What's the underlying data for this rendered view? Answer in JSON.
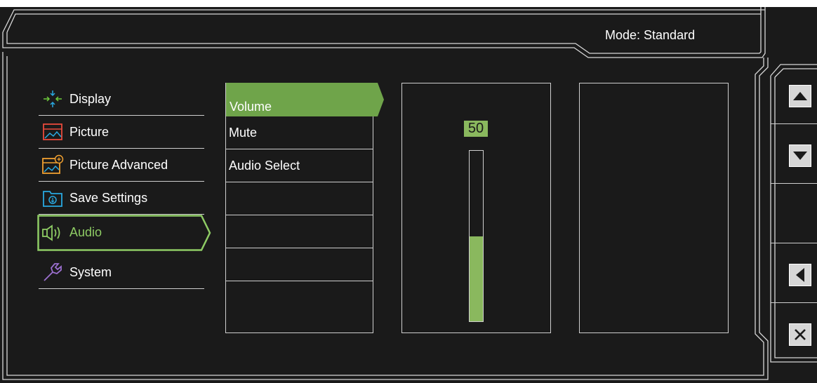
{
  "header": {
    "mode_text": "Mode: Standard"
  },
  "menu": {
    "items": [
      {
        "label": "Display",
        "icon": "display-icon",
        "color": "#6ecb3c"
      },
      {
        "label": "Picture",
        "icon": "picture-icon",
        "color": "#e84a3c"
      },
      {
        "label": "Picture Advanced",
        "icon": "picture-advanced-icon",
        "color": "#f0a030"
      },
      {
        "label": "Save Settings",
        "icon": "save-settings-icon",
        "color": "#29a8e0"
      },
      {
        "label": "Audio",
        "icon": "audio-icon",
        "color": "#8ecb64",
        "active": true
      },
      {
        "label": "System",
        "icon": "system-icon",
        "color": "#9b6fcf"
      }
    ]
  },
  "submenu": {
    "items": [
      "Volume",
      "Mute",
      "Audio Select",
      "",
      "",
      "",
      "",
      ""
    ],
    "active_index": 0
  },
  "volume": {
    "value": "50",
    "level": 0.5
  },
  "keys": [
    "up-arrow-icon",
    "down-arrow-icon",
    "left-arrow-icon",
    "close-x-icon"
  ],
  "colors": {
    "accent": "#8ab85e",
    "background": "#1a1a1a",
    "line": "#cfcfcf"
  }
}
